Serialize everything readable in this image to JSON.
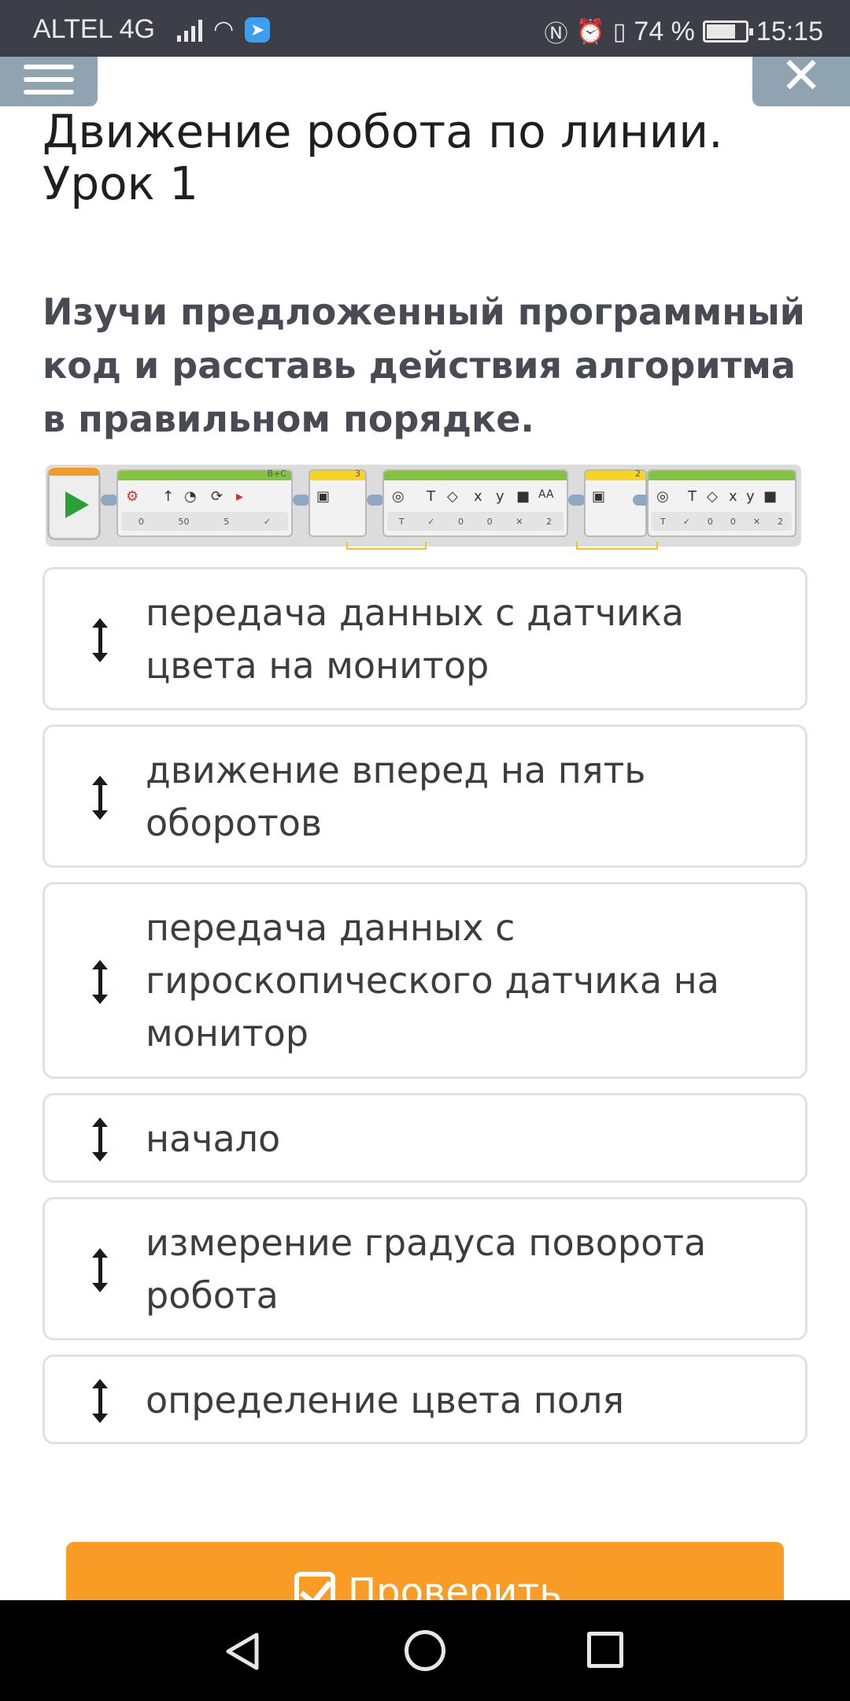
{
  "status_bar": {
    "carrier": "ALTEL 4G",
    "battery_percent": "74 %",
    "time": "15:15",
    "battery_level": 0.74
  },
  "header": {
    "title": "Движение робота по линии. Урок 1",
    "menu_icon": "hamburger-icon",
    "close_icon": "close-icon"
  },
  "task": {
    "instruction": "Изучи предложенный программный код и расставь действия алгоритма в правильном порядке."
  },
  "program_image": {
    "labels": [
      "B+C",
      "3",
      "2",
      "0",
      "50",
      "5",
      "0",
      "0",
      "2",
      "0",
      "0",
      "2",
      "T",
      "x",
      "y",
      "AA"
    ]
  },
  "items": [
    {
      "text": "передача данных с датчика цвета на монитор"
    },
    {
      "text": "движение вперед на пять оборотов"
    },
    {
      "text": "передача данных с гироскопического датчика на монитор"
    },
    {
      "text": "начало"
    },
    {
      "text": "измерение градуса поворота робота"
    },
    {
      "text": "определение цвета поля"
    }
  ],
  "check_button": {
    "label": "Проверить",
    "color": "#f89c25"
  }
}
